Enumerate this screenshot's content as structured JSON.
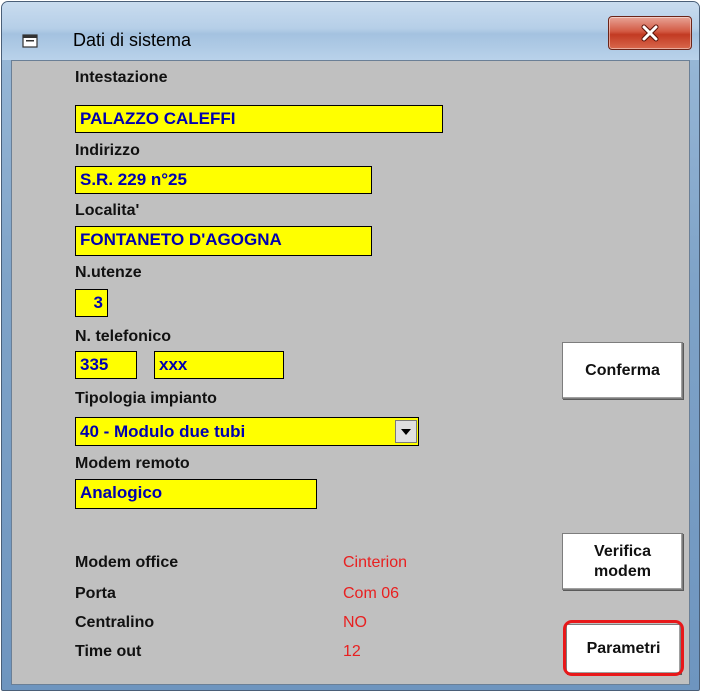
{
  "window": {
    "title": "Dati di sistema",
    "icon": "window-app-icon",
    "close_icon": "close-x-icon"
  },
  "form": {
    "intestazione": {
      "label": "Intestazione",
      "value": "PALAZZO CALEFFI"
    },
    "indirizzo": {
      "label": "Indirizzo",
      "value": "S.R. 229 n°25"
    },
    "localita": {
      "label": "Localita'",
      "value": "FONTANETO D'AGOGNA"
    },
    "utenze": {
      "label": "N.utenze",
      "value": "3"
    },
    "telefono": {
      "label": "N. telefonico",
      "prefix": "335",
      "number": "xxx"
    },
    "tipologia": {
      "label": "Tipologia impianto",
      "value": "40 - Modulo due tubi",
      "dropdown_icon": "chevron-down-icon"
    },
    "modem_remoto": {
      "label": "Modem  remoto",
      "value": "Analogico"
    }
  },
  "info": {
    "modem_office": {
      "label": "Modem office",
      "value": "Cinterion"
    },
    "porta": {
      "label": "Porta",
      "value": "Com 06"
    },
    "centralino": {
      "label": "Centralino",
      "value": "NO"
    },
    "timeout": {
      "label": "Time out",
      "value": "12"
    }
  },
  "buttons": {
    "conferma": "Conferma",
    "verifica_line1": "Verifica",
    "verifica_line2": "modem",
    "parametri": "Parametri"
  },
  "colors": {
    "field_bg": "#ffff00",
    "field_text": "#0000b0",
    "info_value": "#e82020",
    "highlight": "#e8181a"
  }
}
